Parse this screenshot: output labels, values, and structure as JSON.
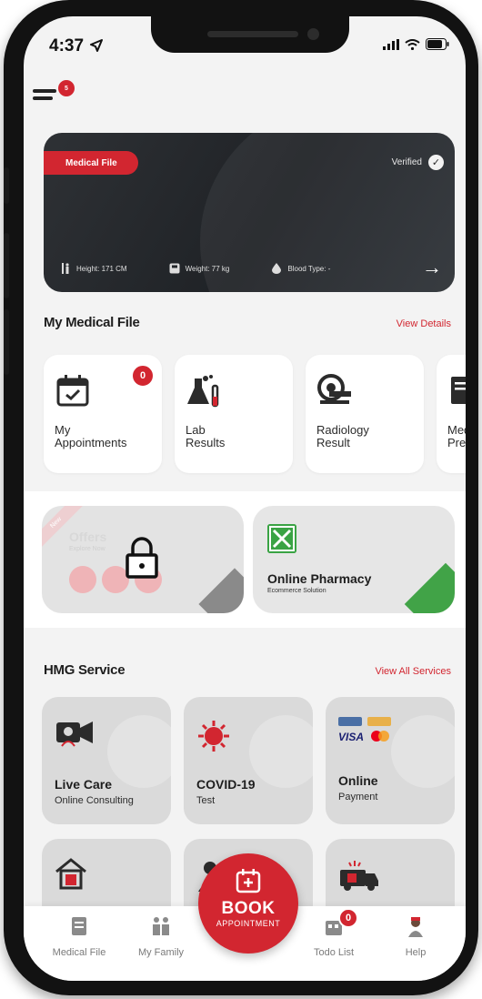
{
  "status_bar": {
    "time": "4:37"
  },
  "menu": {
    "badge": "5"
  },
  "medical_card": {
    "label": "Medical File",
    "verified": "Verified",
    "height": "Height: 171 CM",
    "weight": "Weight: 77 kg",
    "blood_type": "Blood Type: -"
  },
  "my_medical_file": {
    "title": "My Medical File",
    "link": "View Details",
    "tiles": [
      {
        "label": "My\nAppointments",
        "badge": "0",
        "icon": "calendar-check-icon"
      },
      {
        "label": "Lab\nResults",
        "icon": "lab-flask-icon"
      },
      {
        "label": "Radiology\nResult",
        "icon": "mri-scanner-icon"
      },
      {
        "label": "Med\nPres",
        "icon": "prescription-icon"
      }
    ]
  },
  "promos": {
    "offers": {
      "ribbon": "New",
      "title": "Offers",
      "subtitle": "Explore Now"
    },
    "pharmacy": {
      "title": "Online Pharmacy",
      "subtitle": "Ecommerce Solution"
    }
  },
  "hmg_service": {
    "title": "HMG Service",
    "link": "View All Services",
    "items": [
      {
        "title": "Live Care",
        "subtitle": "Online Consulting",
        "icon": "video-doctor-icon"
      },
      {
        "title": "COVID-19",
        "subtitle": "Test",
        "icon": "virus-icon"
      },
      {
        "title": "Online",
        "subtitle": "Payment",
        "icon": "payment-cards-icon"
      },
      {
        "title": "",
        "subtitle": "",
        "icon": "home-health-icon"
      },
      {
        "title": "",
        "subtitle": "",
        "icon": "doctor-icon"
      },
      {
        "title": "",
        "subtitle": "",
        "icon": "ambulance-icon"
      }
    ]
  },
  "bottom_nav": {
    "medical_file": "Medical File",
    "my_family": "My Family",
    "todo_list": "Todo List",
    "todo_badge": "0",
    "help": "Help"
  },
  "book_button": {
    "title": "BOOK",
    "subtitle": "APPOINTMENT"
  },
  "colors": {
    "accent": "#d22630",
    "pharmacy_green": "#41a347",
    "card_dark": "#23262a"
  }
}
